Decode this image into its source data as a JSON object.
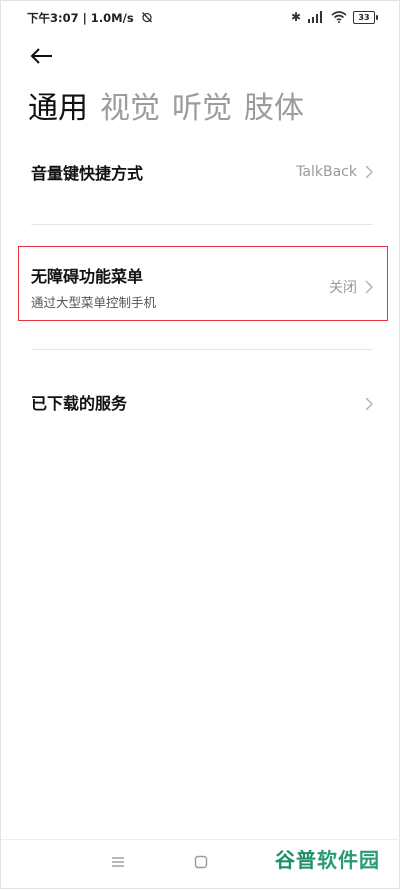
{
  "status_bar": {
    "time_network": "下午3:07 | 1.0M/s",
    "battery": "33",
    "bluetooth": "✱"
  },
  "tabs": [
    {
      "label": "通用",
      "active": true
    },
    {
      "label": "视觉",
      "active": false
    },
    {
      "label": "听觉",
      "active": false
    },
    {
      "label": "肢体",
      "active": false
    }
  ],
  "settings": {
    "volume_shortcut": {
      "title": "音量键快捷方式",
      "value": "TalkBack"
    },
    "accessibility_menu": {
      "title": "无障碍功能菜单",
      "subtitle": "通过大型菜单控制手机",
      "value": "关闭"
    },
    "downloaded_services": {
      "title": "已下载的服务"
    }
  },
  "watermark": {
    "text_a": "谷普",
    "text_b": "软件园"
  },
  "colors": {
    "highlight": "#e8323c",
    "watermark": "#2a9a74",
    "inactive_tab": "#9c9c9c"
  }
}
